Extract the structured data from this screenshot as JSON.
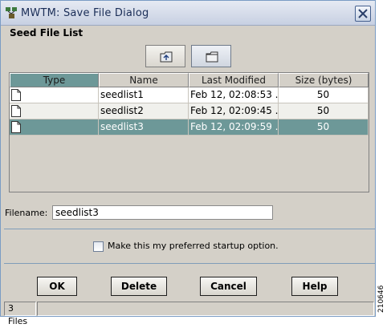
{
  "window": {
    "title": "MWTM: Save File Dialog",
    "icons": {
      "app": "app-network-icon",
      "close": "close-icon"
    }
  },
  "file_list": {
    "group_label": "Seed File List",
    "toolbar": {
      "up_folder_icon": "up-folder-icon",
      "new_folder_icon": "new-folder-icon"
    },
    "columns": [
      "Type",
      "Name",
      "Last Modified",
      "Size (bytes)"
    ],
    "sorted_column": "Type",
    "rows": [
      {
        "type_icon": "file-icon",
        "name": "seedlist1",
        "modified": "Feb 12, 02:08:53 ...",
        "size": "50",
        "selected": false
      },
      {
        "type_icon": "file-icon",
        "name": "seedlist2",
        "modified": "Feb 12, 02:09:45 ...",
        "size": "50",
        "selected": false
      },
      {
        "type_icon": "file-icon",
        "name": "seedlist3",
        "modified": "Feb 12, 02:09:59 ...",
        "size": "50",
        "selected": true
      }
    ]
  },
  "filename": {
    "label": "Filename:",
    "value": "seedlist3"
  },
  "preference": {
    "label": "Make this my preferred startup option.",
    "checked": false
  },
  "buttons": {
    "ok": "OK",
    "delete": "Delete",
    "cancel": "Cancel",
    "help": "Help"
  },
  "status": {
    "text": "3 Files"
  },
  "side_id": "210646",
  "colors": {
    "selection": "#6d9898",
    "dialog_bg": "#d4d0c8",
    "title_text": "#1a2d57"
  }
}
